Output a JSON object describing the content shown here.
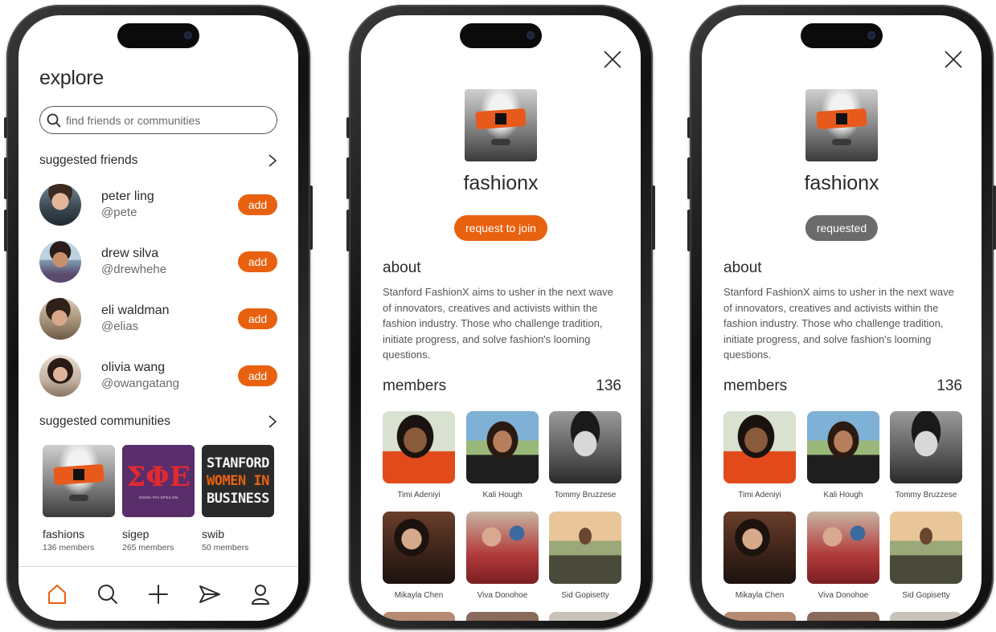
{
  "explore": {
    "title": "explore",
    "search_placeholder": "find friends or communities",
    "suggested_friends_label": "suggested friends",
    "friends": [
      {
        "name": "peter ling",
        "handle": "@pete",
        "action": "add"
      },
      {
        "name": "drew silva",
        "handle": "@drewhehe",
        "action": "add"
      },
      {
        "name": "eli waldman",
        "handle": "@elias",
        "action": "add"
      },
      {
        "name": "olivia wang",
        "handle": "@owangatang",
        "action": "add"
      }
    ],
    "suggested_communities_label": "suggested communities",
    "communities": [
      {
        "name": "fashions",
        "members": "136 members"
      },
      {
        "name": "sigep",
        "members": "265 members",
        "logo_text": "ΣΦΕ",
        "logo_subtext": "SIGMA PHI EPSILON"
      },
      {
        "name": "swib",
        "members": "50 members",
        "logo_lines": [
          "STANFORD",
          "WOMEN IN",
          "BUSINESS"
        ]
      }
    ],
    "tabs": [
      "home-icon",
      "search-icon",
      "plus-icon",
      "send-icon",
      "profile-icon"
    ]
  },
  "group": {
    "name": "fashionx",
    "request_label": "request to join",
    "requested_label": "requested",
    "about_title": "about",
    "about_text": "Stanford FashionX aims to usher in the next wave of innovators, creatives and activists within the fashion industry. Those who challenge tradition, initiate progress, and solve fashion's looming questions.",
    "members_label": "members",
    "members_count": "136",
    "members": [
      "Timi Adeniyi",
      "Kali Hough",
      "Tommy Bruzzese",
      "Mikayla Chen",
      "Viva Donohoe",
      "Sid Gopisetty"
    ]
  },
  "colors": {
    "accent": "#e8610f",
    "requested_gray": "#6b6b6b",
    "text": "#2b2b2b",
    "muted": "#6a6a6a"
  }
}
